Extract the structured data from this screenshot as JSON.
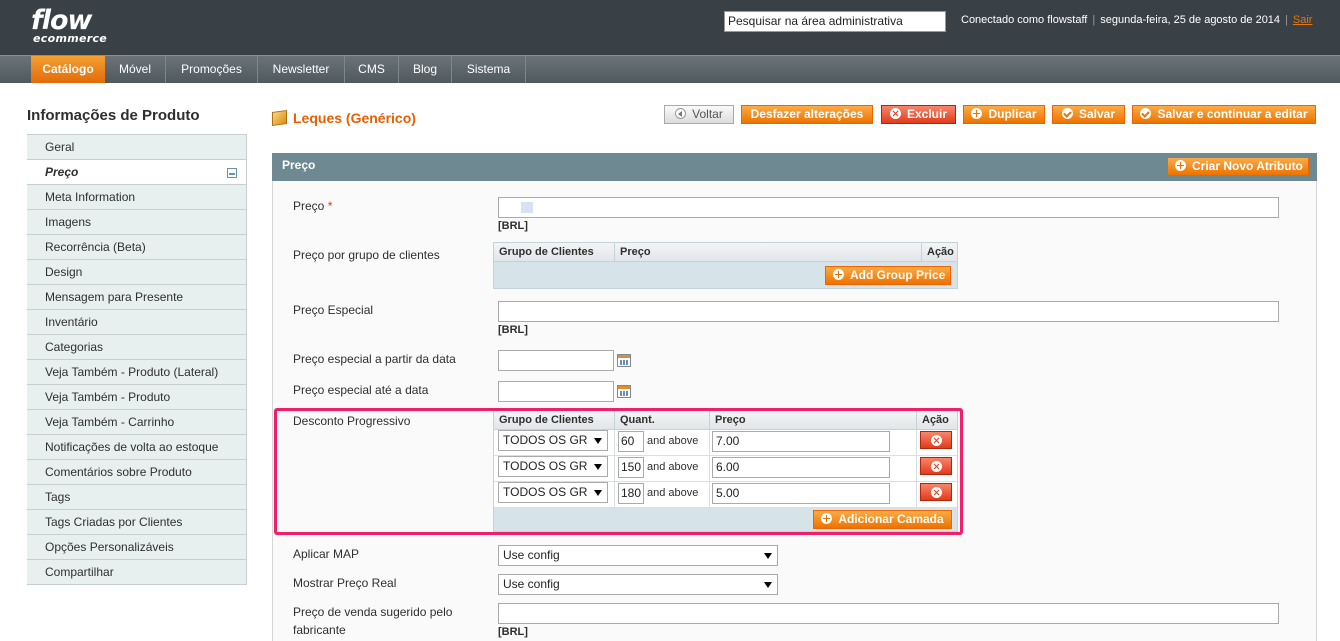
{
  "header": {
    "logo_line1": "flow",
    "logo_line2": "ecommerce",
    "search_value": "Pesquisar na área administrativa",
    "connected_as": "Conectado como flowstaff",
    "date": "segunda-feira, 25 de agosto de 2014",
    "logout": "Sair"
  },
  "nav": [
    "Catálogo",
    "Móvel",
    "Promoções",
    "Newsletter",
    "CMS",
    "Blog",
    "Sistema"
  ],
  "sidebar": {
    "title": "Informações de Produto",
    "items": [
      "Geral",
      "Preço",
      "Meta Information",
      "Imagens",
      "Recorrência (Beta)",
      "Design",
      "Mensagem para Presente",
      "Inventário",
      "Categorias",
      "Veja Também - Produto (Lateral)",
      "Veja Também - Produto",
      "Veja Também - Carrinho",
      "Notificações de volta ao estoque",
      "Comentários sobre Produto",
      "Tags",
      "Tags Criadas por Clientes",
      "Opções Personalizáveis",
      "Compartilhar"
    ]
  },
  "page": {
    "title": "Leques (Genérico)",
    "buttons": {
      "back": "Voltar",
      "reset": "Desfazer alterações",
      "delete": "Excluir",
      "duplicate": "Duplicar",
      "save": "Salvar",
      "save_continue": "Salvar e continuar a editar"
    }
  },
  "section": {
    "title": "Preço",
    "new_attribute": "Criar Novo Atributo",
    "price_label": "Preço",
    "required_mark": "*",
    "currency": "[BRL]",
    "group_price_label": "Preço por grupo de clientes",
    "group_price_headers": [
      "Grupo de Clientes",
      "Preço",
      "Ação"
    ],
    "add_group_price": "Add Group Price",
    "special_price_label": "Preço Especial",
    "special_from_label": "Preço especial a partir da data",
    "special_to_label": "Preço especial até a data",
    "tier_label": "Desconto Progressivo",
    "tier_headers": [
      "Grupo de Clientes",
      "Quant.",
      "Preço",
      "Ação"
    ],
    "tier_rows": [
      {
        "group": "TODOS OS GR",
        "qty": "60",
        "above": "and above",
        "price": "7.00"
      },
      {
        "group": "TODOS OS GR",
        "qty": "150",
        "above": "and above",
        "price": "6.00"
      },
      {
        "group": "TODOS OS GR",
        "qty": "180",
        "above": "and above",
        "price": "5.00"
      }
    ],
    "add_tier": "Adicionar Camada",
    "map_label": "Aplicar MAP",
    "map_value": "Use config",
    "show_price_label": "Mostrar Preço Real",
    "show_price_value": "Use config",
    "msrp_label_line1": "Preço de venda sugerido pelo",
    "msrp_label_line2": "fabricante"
  }
}
